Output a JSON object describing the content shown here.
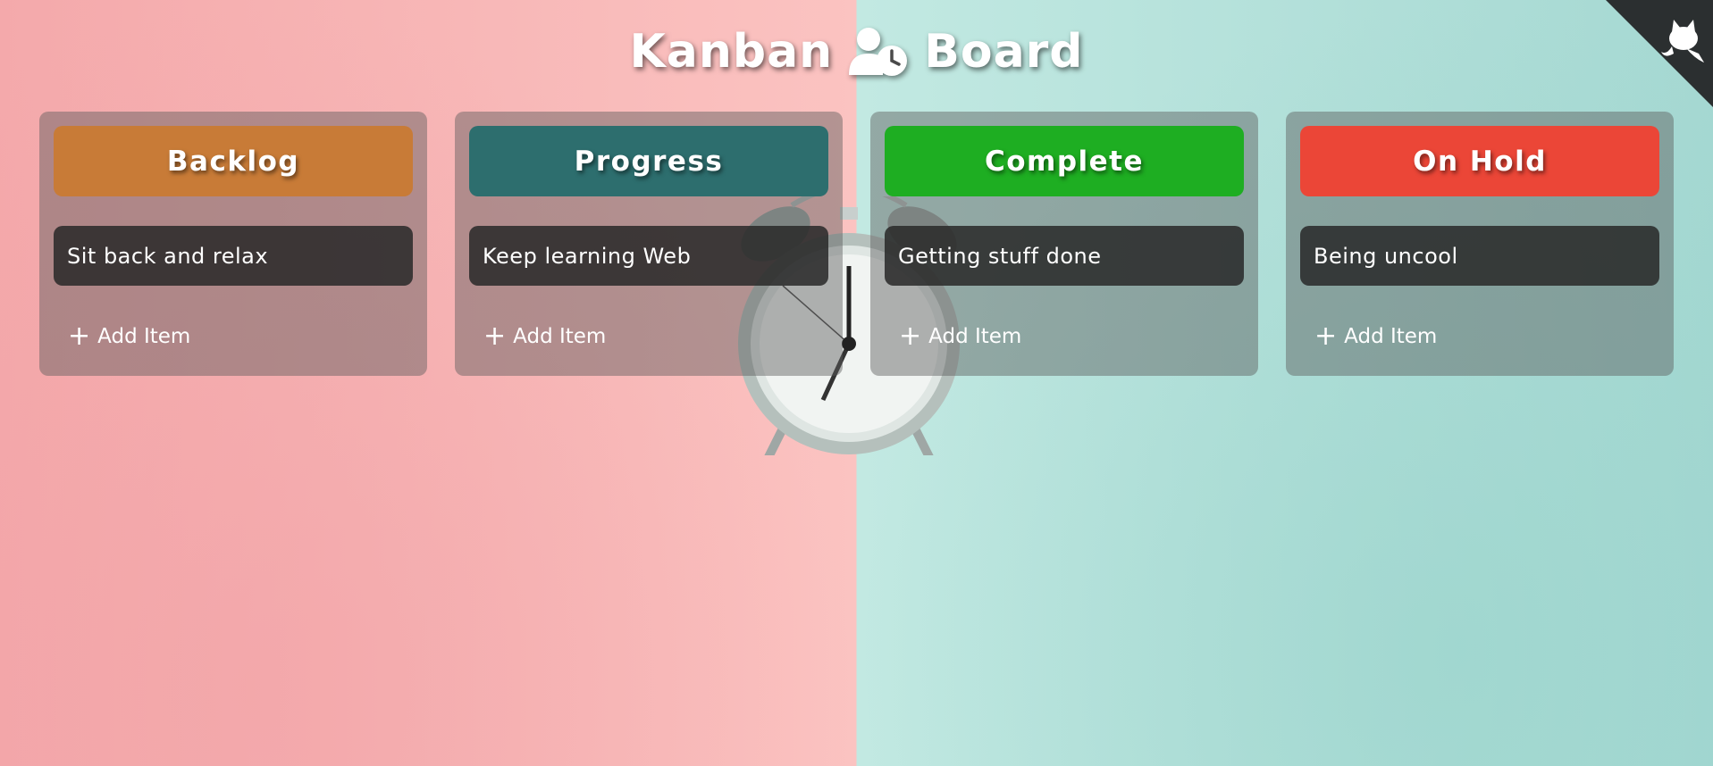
{
  "header": {
    "title_left": "Kanban",
    "title_right": "Board",
    "title_icon": "user-clock-icon"
  },
  "corner_link": {
    "icon": "github-cat-icon"
  },
  "columns": [
    {
      "title": "Backlog",
      "color": "#c87b37",
      "items": [
        "Sit back and relax"
      ]
    },
    {
      "title": "Progress",
      "color": "#2d6e6e",
      "items": [
        "Keep learning Web"
      ]
    },
    {
      "title": "Complete",
      "color": "#1eae22",
      "items": [
        "Getting stuff done"
      ]
    },
    {
      "title": "On Hold",
      "color": "#eb4637",
      "items": [
        "Being uncool"
      ]
    }
  ],
  "add_item_label": "Add Item",
  "add_item_icon": "plus-icon"
}
